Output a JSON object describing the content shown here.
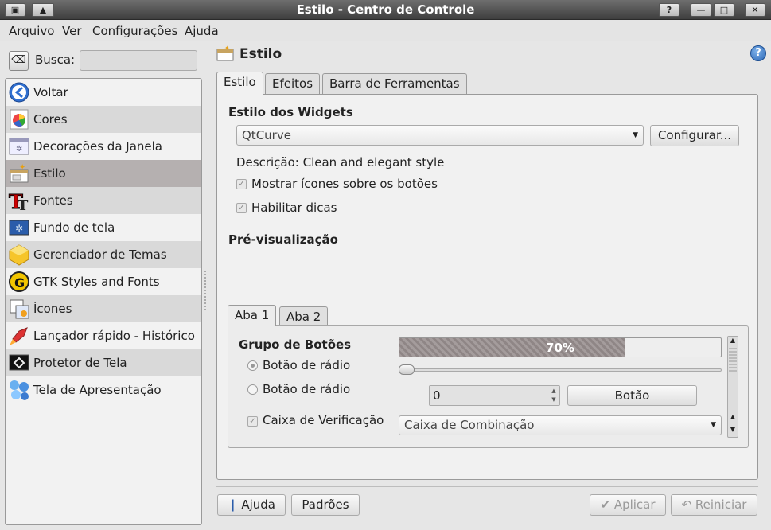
{
  "window": {
    "title": "Estilo - Centro de Controle",
    "btn_help": "?",
    "btn_min": "—",
    "btn_max": "□",
    "btn_close": "✕",
    "btn_shade": "▲"
  },
  "menu": [
    "Arquivo",
    "Ver",
    "Configurações",
    "Ajuda"
  ],
  "search": {
    "label": "Busca:",
    "value": ""
  },
  "sidebar": {
    "items": [
      {
        "label": "Voltar",
        "icon": "back-arrow-icon"
      },
      {
        "label": "Cores",
        "icon": "color-palette-icon"
      },
      {
        "label": "Decorações da Janela",
        "icon": "window-decoration-icon"
      },
      {
        "label": "Estilo",
        "icon": "style-icon",
        "selected": true
      },
      {
        "label": "Fontes",
        "icon": "fonts-icon"
      },
      {
        "label": "Fundo de tela",
        "icon": "wallpaper-icon"
      },
      {
        "label": "Gerenciador de Temas",
        "icon": "theme-manager-icon"
      },
      {
        "label": "GTK Styles and Fonts",
        "icon": "gtk-icon"
      },
      {
        "label": "Ícones",
        "icon": "icons-icon"
      },
      {
        "label": "Lançador rápido - Histórico",
        "icon": "rocket-icon"
      },
      {
        "label": "Protetor de Tela",
        "icon": "screensaver-icon"
      },
      {
        "label": "Tela de Apresentação",
        "icon": "splash-icon"
      }
    ]
  },
  "header": {
    "title": "Estilo",
    "help": "?"
  },
  "tabs": [
    "Estilo",
    "Efeitos",
    "Barra de Ferramentas"
  ],
  "widgets": {
    "section": "Estilo dos Widgets",
    "style_value": "QtCurve",
    "configure_label": "Configurar...",
    "description": "Descrição: Clean and elegant style",
    "show_icons_label": "Mostrar ícones sobre os botões",
    "tooltips_label": "Habilitar dicas"
  },
  "preview": {
    "section": "Pré-visualização",
    "tabs": [
      "Aba 1",
      "Aba 2"
    ],
    "group_title": "Grupo de Botões",
    "radio1": "Botão de rádio",
    "radio2": "Botão de rádio",
    "checkbox": "Caixa de Verificação",
    "progress": 0.7,
    "progress_label": "70%",
    "spin_value": "0",
    "button_label": "Botão",
    "combo_label": "Caixa de Combinação"
  },
  "footer": {
    "help": "Ajuda",
    "defaults": "Padrões",
    "apply": "Aplicar",
    "reset": "Reiniciar"
  },
  "colors": {
    "selected": "#b5b0b0",
    "alt_row": "#d9d9d9",
    "titlebar": "#4a4a4a"
  }
}
